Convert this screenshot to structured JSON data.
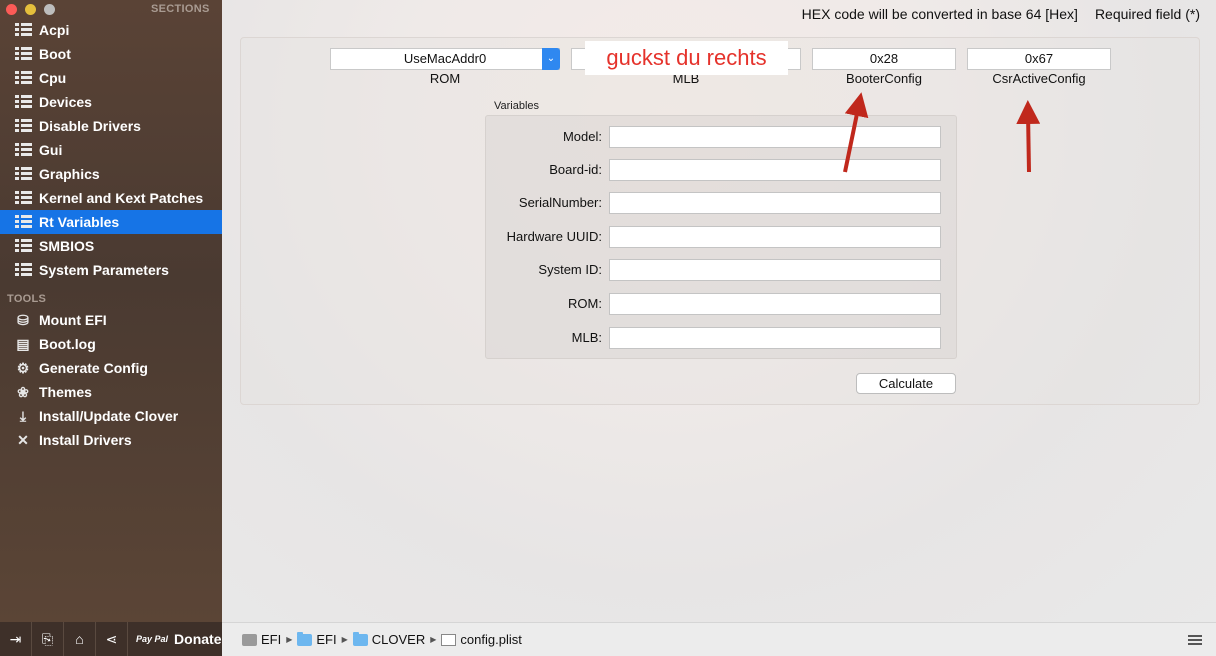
{
  "window": {
    "top_note": "HEX code will be converted in base 64 [Hex]",
    "required_note": "Required field (*)"
  },
  "sidebar": {
    "sections_header": "SECTIONS",
    "sections": [
      {
        "label": "Acpi"
      },
      {
        "label": "Boot"
      },
      {
        "label": "Cpu"
      },
      {
        "label": "Devices"
      },
      {
        "label": "Disable Drivers"
      },
      {
        "label": "Gui"
      },
      {
        "label": "Graphics"
      },
      {
        "label": "Kernel and Kext Patches"
      },
      {
        "label": "Rt Variables",
        "active": true
      },
      {
        "label": "SMBIOS"
      },
      {
        "label": "System Parameters"
      }
    ],
    "tools_header": "TOOLS",
    "tools": [
      {
        "label": "Mount EFI",
        "icon": "disk-icon",
        "glyph": "⛁"
      },
      {
        "label": "Boot.log",
        "icon": "log-icon",
        "glyph": "▤"
      },
      {
        "label": "Generate Config",
        "icon": "gears-icon",
        "glyph": "⚙"
      },
      {
        "label": "Themes",
        "icon": "palette-icon",
        "glyph": "❀"
      },
      {
        "label": "Install/Update Clover",
        "icon": "download-icon",
        "glyph": "⤓"
      },
      {
        "label": "Install Drivers",
        "icon": "tools-icon",
        "glyph": "✕"
      }
    ]
  },
  "rt": {
    "rom_select": "UseMacAddr0",
    "rom_label": "ROM",
    "mlb_value": "",
    "mlb_label": "MLB",
    "booter_value": "0x28",
    "booter_label": "BooterConfig",
    "csr_value": "0x67",
    "csr_label": "CsrActiveConfig",
    "annotation": "guckst du rechts",
    "vars_title": "Variables",
    "vars": [
      {
        "label": "Model:",
        "value": ""
      },
      {
        "label": "Board-id:",
        "value": ""
      },
      {
        "label": "SerialNumber:",
        "value": ""
      },
      {
        "label": "Hardware UUID:",
        "value": ""
      },
      {
        "label": "System ID:",
        "value": ""
      },
      {
        "label": "ROM:",
        "value": ""
      },
      {
        "label": "MLB:",
        "value": ""
      }
    ],
    "calculate_label": "Calculate",
    "arrow_color": "#c0281c"
  },
  "footer": {
    "donate_label": "Donate",
    "paypal_text": "Pay Pal",
    "path": [
      "EFI",
      "EFI",
      "CLOVER",
      "config.plist"
    ]
  }
}
